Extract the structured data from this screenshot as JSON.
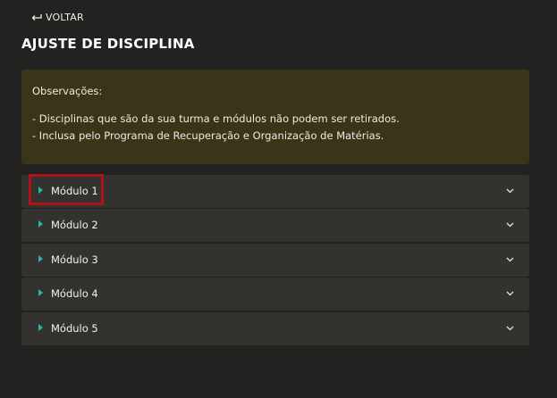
{
  "nav": {
    "back_label": "VOLTAR"
  },
  "page": {
    "title": "AJUSTE DE DISCIPLINA"
  },
  "observations": {
    "heading": "Observações:",
    "lines": [
      "- Disciplinas que são da sua turma e módulos não podem ser retirados.",
      "- Inclusa pelo Programa de Recuperação e Organização de Matérias."
    ]
  },
  "modules": [
    {
      "label": "Módulo 1"
    },
    {
      "label": "Módulo 2"
    },
    {
      "label": "Módulo 3"
    },
    {
      "label": "Módulo 4"
    },
    {
      "label": "Módulo 5"
    }
  ],
  "colors": {
    "background": "#222220",
    "observations_bg": "#3a3418",
    "module_bg": "#33322e",
    "accent_triangle": "#2fb3a5",
    "highlight_border": "#b0121b"
  }
}
